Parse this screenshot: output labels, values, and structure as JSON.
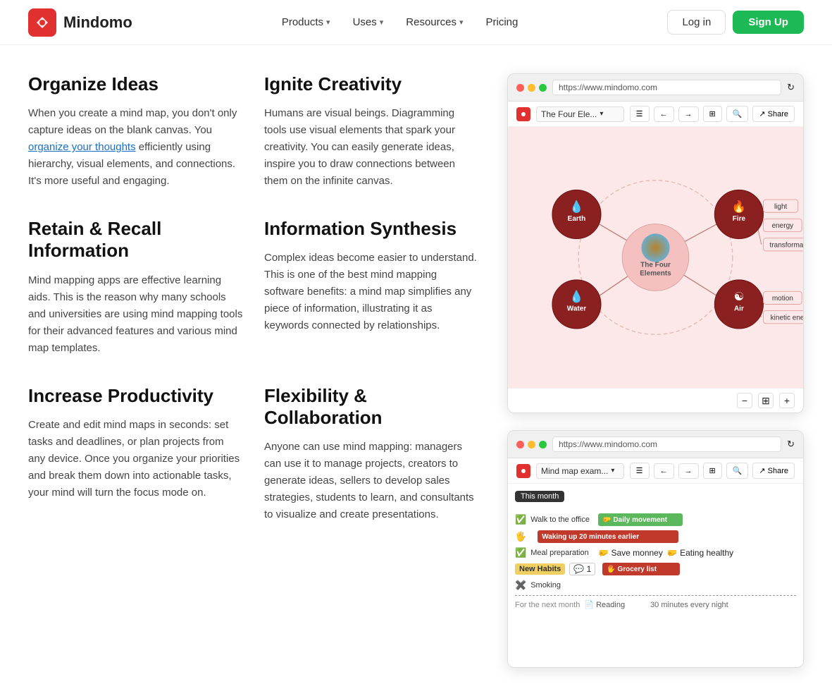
{
  "navbar": {
    "logo_text": "Mindomo",
    "nav_items": [
      {
        "label": "Products",
        "has_chevron": true
      },
      {
        "label": "Uses",
        "has_chevron": true
      },
      {
        "label": "Resources",
        "has_chevron": true
      },
      {
        "label": "Pricing",
        "has_chevron": false
      }
    ],
    "login_label": "Log in",
    "signup_label": "Sign Up"
  },
  "features": [
    {
      "title": "Organize Ideas",
      "desc_before_link": "When you create a mind map, you don't only capture ideas on the blank canvas. You ",
      "link_text": "organize your thoughts",
      "desc_after_link": " efficiently using hierarchy, visual elements, and connections. It's more useful and engaging."
    },
    {
      "title": "Ignite Creativity",
      "desc": "Humans are visual beings. Diagramming tools use visual elements that spark your creativity. You can easily generate ideas, inspire you to draw connections between them on the infinite canvas."
    },
    {
      "title": "Retain & Recall Information",
      "desc": "Mind mapping apps are effective learning aids. This is the reason why many schools and universities are using mind mapping tools for their advanced features and various mind map templates."
    },
    {
      "title": "Information Synthesis",
      "desc": "Complex ideas become easier to understand. This is one of the best mind mapping software benefits: a mind map simplifies any piece of information, illustrating it as keywords connected by relationships."
    },
    {
      "title": "Increase Productivity",
      "desc": "Create and edit mind maps in seconds: set tasks and deadlines, or plan projects from any device. Once you organize your priorities and break them down into actionable tasks, your mind will turn the focus mode on."
    },
    {
      "title": "Flexibility & Collaboration",
      "desc": "Anyone can use mind mapping: managers can use it to manage projects, creators to generate ideas, sellers to develop sales strategies, students to learn, and consultants to visualize and create presentations."
    }
  ],
  "browser1": {
    "url": "https://www.mindomo.com",
    "title": "The Four Ele...",
    "share_label": "Share",
    "mindmap": {
      "center": "The Four Elements",
      "nodes": [
        "Earth",
        "Fire",
        "Water",
        "Air"
      ],
      "fire_tags": [
        "light",
        "energy",
        "transformation"
      ],
      "air_tags": [
        "motion",
        "kinetic energy"
      ]
    }
  },
  "browser2": {
    "title": "Mind map exam...",
    "share_label": "Share",
    "gantt": {
      "header": "This month",
      "rows": [
        {
          "check": "green",
          "label": "Walk to the office",
          "bar_label": "Daily movement",
          "bar_type": "green"
        },
        {
          "check": "red_warn",
          "label": "Waking up 20 minutes earlier",
          "bar_type": "red"
        },
        {
          "check": "green",
          "label": "Meal preparation",
          "icons": [
            "Save monney",
            "Eating healthy"
          ],
          "bar_type": "green"
        },
        {
          "tag": "New Habits",
          "tag_comment": "1",
          "label": "Grocery list",
          "bar_type": "red"
        },
        {
          "check": "red_x",
          "label": "Smoking",
          "bar_type": "none"
        },
        {
          "section": "For the next month"
        },
        {
          "label": "Reading",
          "bar_label": "30 minutes every night",
          "bar_type": "none"
        }
      ]
    }
  }
}
